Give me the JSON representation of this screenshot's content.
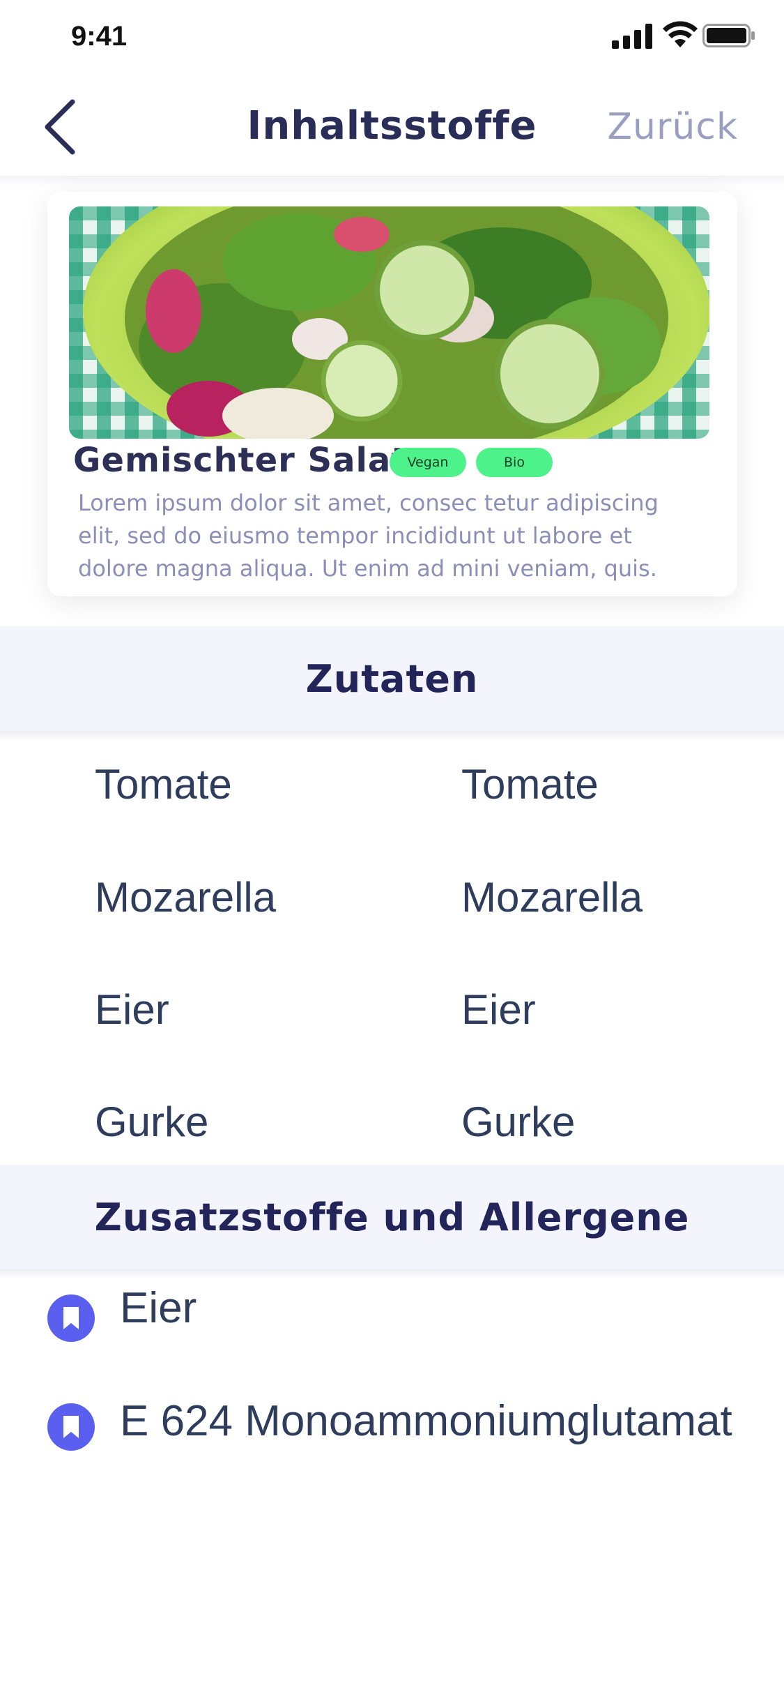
{
  "status_bar": {
    "time": "9:41"
  },
  "nav": {
    "title": "Inhaltsstoffe",
    "right_label": "Zurück"
  },
  "card": {
    "title": "Gemischter Salat",
    "tags": [
      "Vegan",
      "Bio"
    ],
    "description": "Lorem ipsum dolor sit amet, consec tetur adipiscing elit, sed do eiusmo tempor incididunt ut labore et dolore magna aliqua. Ut enim ad mini veniam, quis."
  },
  "ingredients": {
    "header": "Zutaten",
    "left": [
      "Tomate",
      "Mozarella",
      "Eier",
      "Gurke"
    ],
    "right": [
      "Tomate",
      "Mozarella",
      "Eier",
      "Gurke"
    ]
  },
  "allergens": {
    "header": "Zusatzstoffe und Allergene",
    "items": [
      "Eier",
      "E 624 Monoammoniumglutamat"
    ]
  },
  "colors": {
    "accent": "#5b5ff0",
    "tag_bg": "#4ef28a",
    "section_bg": "#f3f4fc",
    "title": "#2a2d57"
  }
}
